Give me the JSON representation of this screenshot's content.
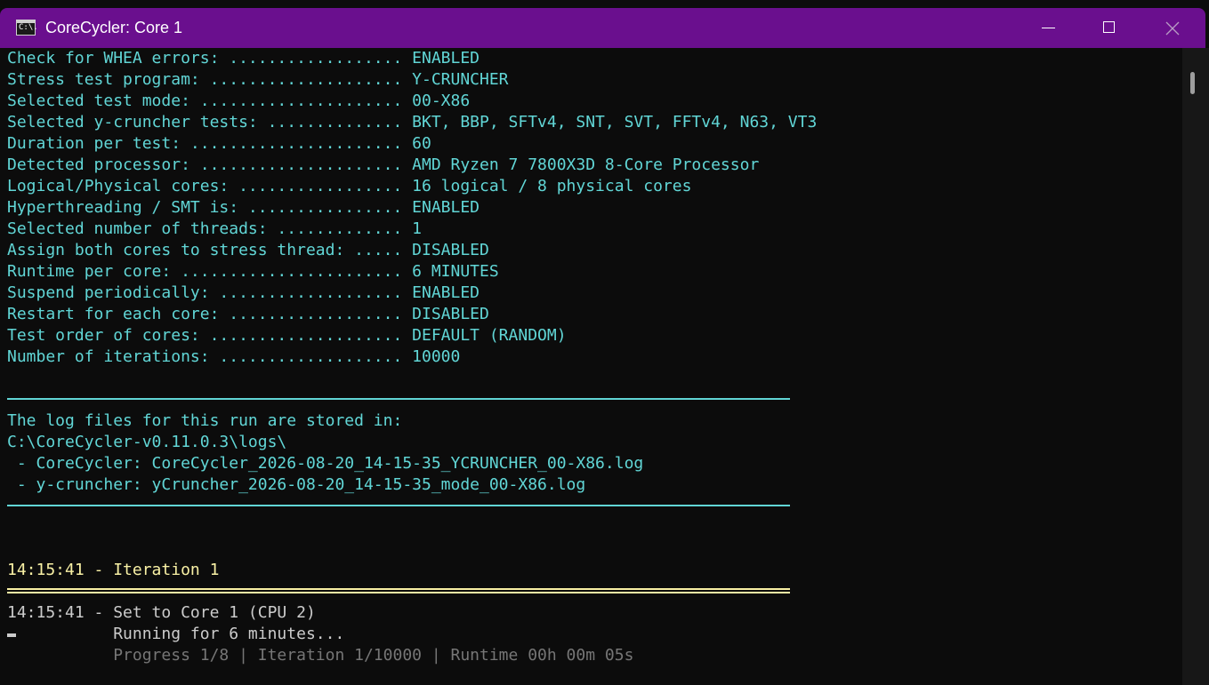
{
  "window": {
    "title": "CoreCycler: Core 1",
    "icon": "console-icon",
    "icon_text": "C:\\."
  },
  "colors": {
    "titlebar": "#6a0f8e",
    "background": "#0c0c0c",
    "cyan": "#61d6d6",
    "yellow": "#f9f1a5",
    "white": "#cccccc",
    "grey": "#767676"
  },
  "console": {
    "settings": [
      "Check for WHEA errors: .................. ENABLED",
      "Stress test program: .................... Y-CRUNCHER",
      "Selected test mode: ..................... 00-X86",
      "Selected y-cruncher tests: .............. BKT, BBP, SFTv4, SNT, SVT, FFTv4, N63, VT3",
      "Duration per test: ...................... 60",
      "Detected processor: ..................... AMD Ryzen 7 7800X3D 8-Core Processor",
      "Logical/Physical cores: ................. 16 logical / 8 physical cores",
      "Hyperthreading / SMT is: ................ ENABLED",
      "Selected number of threads: ............. 1",
      "Assign both cores to stress thread: ..... DISABLED",
      "Runtime per core: ....................... 6 MINUTES",
      "Suspend periodically: ................... ENABLED",
      "Restart for each core: .................. DISABLED",
      "Test order of cores: .................... DEFAULT (RANDOM)",
      "Number of iterations: ................... 10000"
    ],
    "log_header": "The log files for this run are stored in:",
    "log_path": "C:\\CoreCycler-v0.11.0.3\\logs\\",
    "log_files": [
      " - CoreCycler: CoreCycler_2026-08-20_14-15-35_YCRUNCHER_00-X86.log",
      " - y-cruncher: yCruncher_2026-08-20_14-15-35_mode_00-X86.log"
    ],
    "iteration_header": "14:15:41 - Iteration 1",
    "status_lines": [
      "14:15:41 - Set to Core 1 (CPU 2)",
      "           Running for 6 minutes..."
    ],
    "progress_line": "           Progress 1/8 | Iteration 1/10000 | Runtime 00h 00m 05s"
  }
}
